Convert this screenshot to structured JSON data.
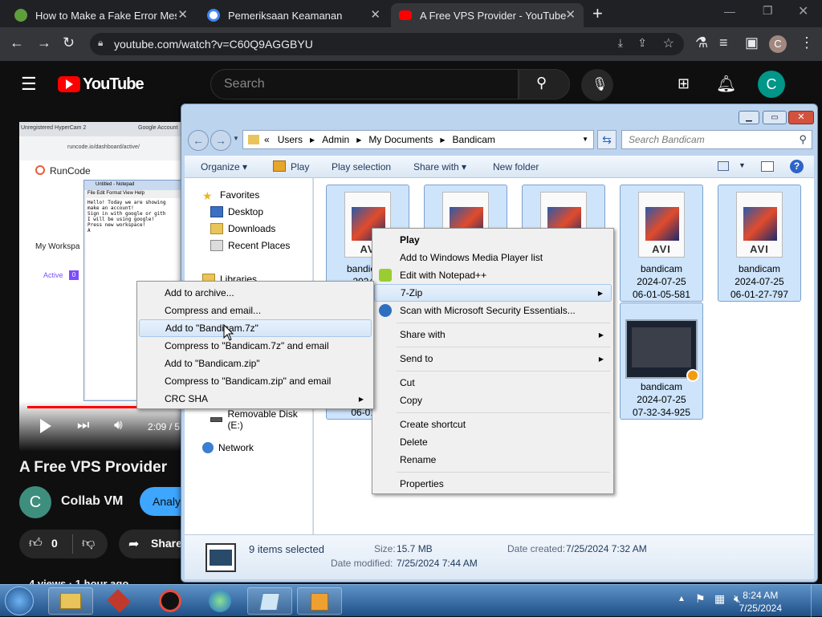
{
  "browser": {
    "tabs": [
      {
        "title": "How to Make a Fake Error Messa",
        "active": false
      },
      {
        "title": "Pemeriksaan Keamanan",
        "active": false
      },
      {
        "title": "A Free VPS Provider - YouTube",
        "active": true
      }
    ],
    "url": "youtube.com/watch?v=C60Q9AGGBYU",
    "profile_initial": "C"
  },
  "youtube": {
    "logo_text": "YouTube",
    "search_placeholder": "Search",
    "avatar_initial": "C",
    "video_title": "A Free VPS Provider",
    "channel_name": "Collab VM",
    "channel_initial": "C",
    "subscribe_label": "Analy",
    "like_count": "0",
    "share_label": "Share",
    "player_time": "2:09 / 5",
    "views_text": "4 views · 1 hour ago",
    "embedded": {
      "tab1": "Unregistered HyperCam 2",
      "tab2": "Google Account",
      "url": "runcode.io/dashboard/active/",
      "brand": "RunCode",
      "workspace_label": "My Workspa",
      "active_label": "Active",
      "active_count": "0",
      "notepad_title": "Untitled - Notepad",
      "notepad_menu": [
        "File",
        "Edit",
        "Format",
        "View",
        "Help"
      ],
      "notepad_lines": [
        "Hello! Today we are showing",
        "make an account!",
        "Sign in with google or gith",
        "I will be using google!",
        "Press new workspace!",
        "A"
      ]
    }
  },
  "explorer": {
    "breadcrumb": [
      "Users",
      "Admin",
      "My Documents",
      "Bandicam"
    ],
    "search_placeholder": "Search Bandicam",
    "commands": [
      "Organize",
      "Play",
      "Play selection",
      "Share with",
      "New folder"
    ],
    "nav": {
      "favorites": "Favorites",
      "desktop": "Desktop",
      "downloads": "Downloads",
      "recent": "Recent Places",
      "libraries": "Libraries",
      "removable": "Removable Disk (E:)",
      "network": "Network"
    },
    "files": [
      {
        "name": "bandicam",
        "date": "2024-0",
        "time": "",
        "badge": "AV"
      },
      {
        "name": "bandicam",
        "date": "2024-07-25",
        "time": "06-01-05-581",
        "badge": "AVI"
      },
      {
        "name": "bandicam",
        "date": "2024-07-25",
        "time": "06-01-27-797",
        "badge": "AVI"
      },
      {
        "name": "bandicam",
        "date": "2024-07-25",
        "time": "07-32-34-925",
        "badge": ""
      }
    ],
    "partial_file_time": "06-01-4",
    "details": {
      "count": "9 items selected",
      "size_label": "Size:",
      "size_value": "15.7 MB",
      "created_label": "Date created:",
      "created_value": "7/25/2024 7:32 AM",
      "modified_label": "Date modified:",
      "modified_value": "7/25/2024 7:44 AM"
    }
  },
  "context_menu": {
    "items": [
      "Play",
      "Add to Windows Media Player list",
      "Edit with Notepad++",
      "7-Zip",
      "Scan with Microsoft Security Essentials...",
      "Share with",
      "Send to",
      "Cut",
      "Copy",
      "Create shortcut",
      "Delete",
      "Rename",
      "Properties"
    ]
  },
  "zip_menu": {
    "items": [
      "Add to archive...",
      "Compress and email...",
      "Add to \"Bandicam.7z\"",
      "Compress to \"Bandicam.7z\" and email",
      "Add to \"Bandicam.zip\"",
      "Compress to \"Bandicam.zip\" and email",
      "CRC SHA"
    ]
  },
  "taskbar": {
    "time": "8:24 AM",
    "date": "7/25/2024"
  }
}
